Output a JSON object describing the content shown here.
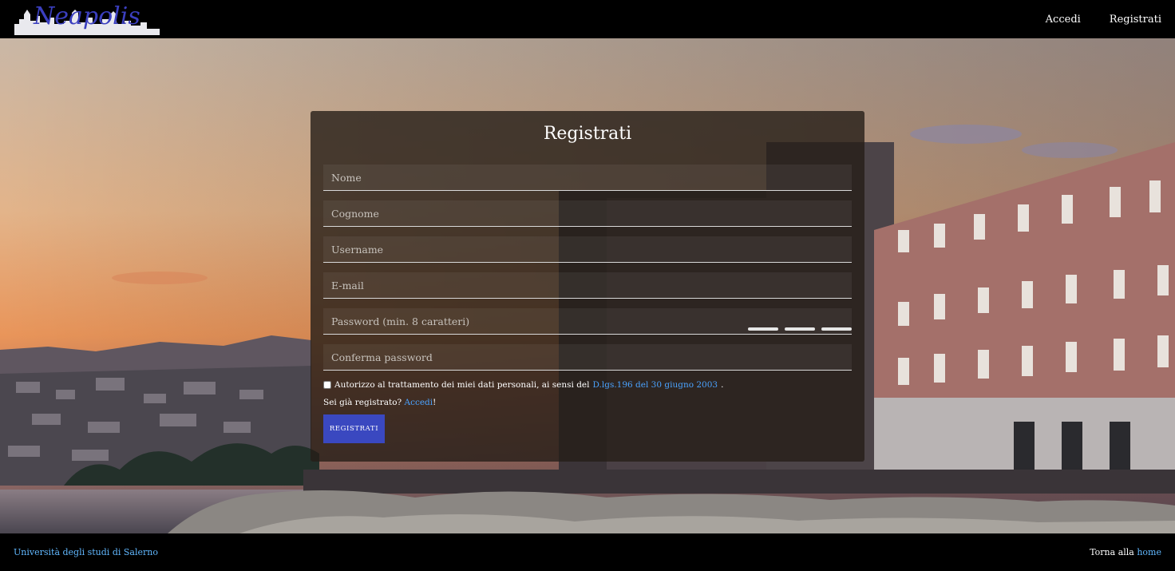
{
  "header": {
    "logo_text": "Neapolis",
    "nav": {
      "login": "Accedi",
      "register": "Registrati"
    }
  },
  "form": {
    "title": "Registrati",
    "fields": {
      "nome": "Nome",
      "cognome": "Cognome",
      "username": "Username",
      "email": "E-mail",
      "password": "Password (min. 8 caratteri)",
      "confirm": "Conferma password"
    },
    "consent_text": "Autorizzo al trattamento dei miei dati personali, ai sensi del",
    "consent_link": "D.lgs.196 del 30 giugno 2003",
    "consent_end": ".",
    "already_text": "Sei già registrato?",
    "already_link": "Accedi",
    "already_end": "!",
    "submit": "REGISTRATI"
  },
  "footer": {
    "university": "Università degli studi di Salerno",
    "back_text": "Torna alla",
    "back_link": "home"
  },
  "colors": {
    "button": "#3a48c0",
    "link": "#4aa3ff",
    "logo_text": "#3b3fbf"
  }
}
